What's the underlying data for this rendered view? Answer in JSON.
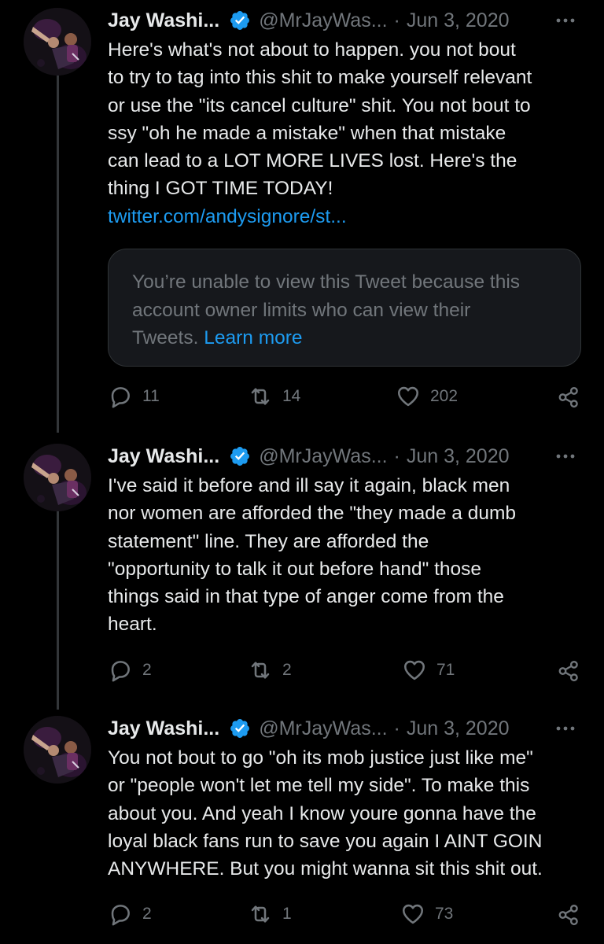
{
  "tweets": [
    {
      "name": "Jay Washi...",
      "handle": "@MrJayWas...",
      "separator": "·",
      "date": "Jun 3, 2020",
      "text": "Here's what's not about to happen. you not bout\nto try to tag into this shit to make yourself relevant\nor use the \"its cancel culture\" shit. You not bout to\nssy \"oh he made a mistake\" when that mistake\ncan lead to a LOT MORE LIVES lost. Here's the\nthing I GOT TIME TODAY!",
      "link": "twitter.com/andysignore/st...",
      "quote": {
        "text": "You’re unable to view this Tweet because this\naccount owner limits who can view their\nTweets. ",
        "learn_more": "Learn more"
      },
      "replies": "11",
      "retweets": "14",
      "likes": "202"
    },
    {
      "name": "Jay Washi...",
      "handle": "@MrJayWas...",
      "separator": "·",
      "date": "Jun 3, 2020",
      "text": "I've said it before and ill say it again, black men\nnor women are afforded the \"they made a dumb\nstatement\" line. They are afforded the\n\"opportunity to talk it out before hand\" those\nthings said in that type of anger come from the\nheart.",
      "replies": "2",
      "retweets": "2",
      "likes": "71"
    },
    {
      "name": "Jay Washi...",
      "handle": "@MrJayWas...",
      "separator": "·",
      "date": "Jun 3, 2020",
      "text": "You not bout to go \"oh its mob justice just like me\"\nor \"people won't let me tell my side\". To make this\nabout you. And yeah I know youre gonna have the\nloyal black fans run to save you again I AINT GOIN\nANYWHERE. But you might wanna sit this shit out.",
      "replies": "2",
      "retweets": "1",
      "likes": "73"
    }
  ],
  "icons": {
    "verified": "verified-badge-icon",
    "more": "more-icon",
    "reply": "reply-icon",
    "retweet": "retweet-icon",
    "like": "heart-icon",
    "share": "share-icon"
  },
  "colors": {
    "background": "#000000",
    "text": "#e7e9ea",
    "muted": "#71767b",
    "link": "#1d9bf0",
    "verified": "#1d9bf0"
  }
}
